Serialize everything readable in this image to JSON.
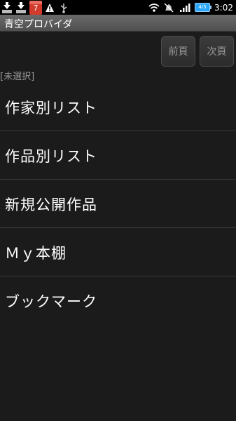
{
  "status_bar": {
    "time": "3:02",
    "calendar_badge": "7",
    "battery_text": "4/5",
    "icons": [
      "download-icon",
      "download-icon",
      "calendar-icon",
      "warning-icon",
      "usb-icon",
      "wifi-icon",
      "silent-icon",
      "signal-icon",
      "battery-icon"
    ]
  },
  "title_bar": {
    "title": "青空プロバイダ"
  },
  "nav": {
    "prev_label": "前頁",
    "next_label": "次頁"
  },
  "selection_label": "[未選択]",
  "menu": {
    "items": [
      {
        "label": "作家別リスト"
      },
      {
        "label": "作品別リスト"
      },
      {
        "label": "新規公開作品"
      },
      {
        "label": "Ｍｙ本棚"
      },
      {
        "label": "ブックマーク"
      }
    ]
  },
  "colors": {
    "background": "#1b1b1b",
    "titlebar": "#5a5a5a",
    "divider": "#3a3a3a"
  }
}
